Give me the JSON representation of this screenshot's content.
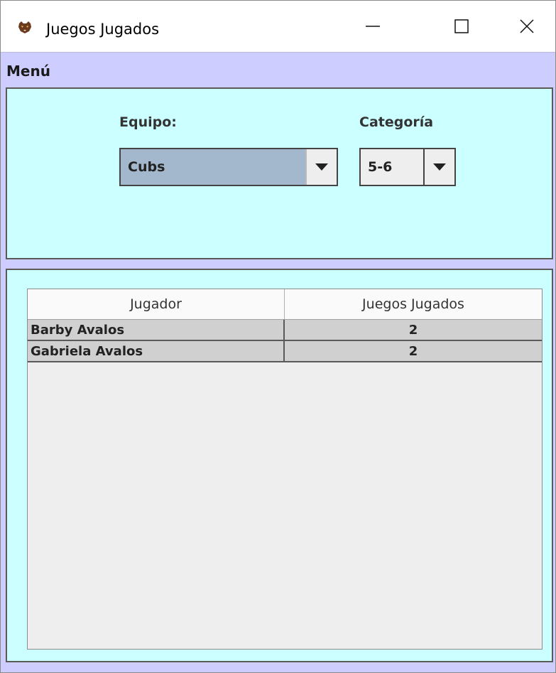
{
  "window": {
    "title": "Juegos Jugados",
    "controls": {
      "minimize": "minimize",
      "maximize": "maximize",
      "close": "close"
    }
  },
  "menubar": {
    "items": [
      {
        "label": "Menú"
      }
    ]
  },
  "filters": {
    "equipo": {
      "label": "Equipo:",
      "value": "Cubs"
    },
    "categoria": {
      "label": "Categoría",
      "value": "5-6"
    }
  },
  "table": {
    "columns": [
      "Jugador",
      "Juegos Jugados"
    ],
    "rows": [
      {
        "jugador": "Barby Avalos",
        "juegos": "2"
      },
      {
        "jugador": "Gabriela Avalos",
        "juegos": "2"
      }
    ]
  },
  "colors": {
    "menu_bg": "#cdcdff",
    "panel_bg": "#ccffff",
    "combo_selected_bg": "#a3b8cc",
    "row_bg": "#d0d0d0"
  },
  "icons": {
    "app": "cougar-head-icon",
    "dropdown": "triangle-down-icon"
  }
}
